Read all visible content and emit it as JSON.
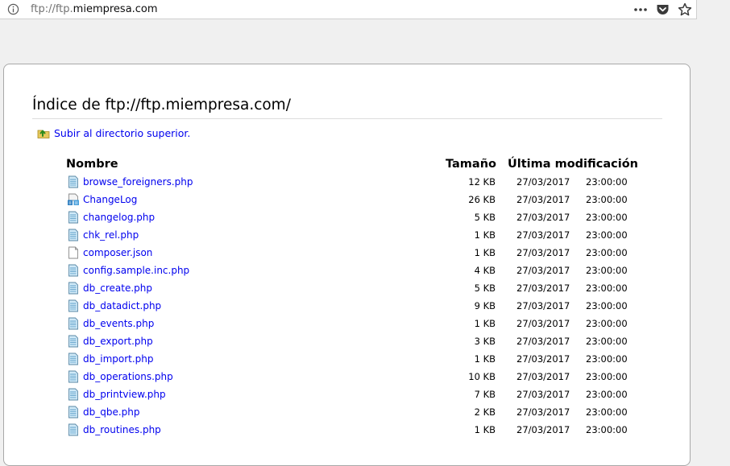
{
  "urlbar": {
    "url_prefix": "ftp://ftp.",
    "url_host": "miempresa.com"
  },
  "page": {
    "heading": "Índice de ftp://ftp.miempresa.com/",
    "up_link": "Subir al directorio superior."
  },
  "table": {
    "headers": {
      "name": "Nombre",
      "size": "Tamaño",
      "modified": "Última modificación"
    },
    "rows": [
      {
        "name": "browse_foreigners.php",
        "icon": "php-file-icon",
        "size": "12 KB",
        "date": "27/03/2017",
        "time": "23:00:00"
      },
      {
        "name": "ChangeLog",
        "icon": "changelog-file-icon",
        "size": "26 KB",
        "date": "27/03/2017",
        "time": "23:00:00"
      },
      {
        "name": "changelog.php",
        "icon": "php-file-icon",
        "size": "5 KB",
        "date": "27/03/2017",
        "time": "23:00:00"
      },
      {
        "name": "chk_rel.php",
        "icon": "php-file-icon",
        "size": "1 KB",
        "date": "27/03/2017",
        "time": "23:00:00"
      },
      {
        "name": "composer.json",
        "icon": "blank-file-icon",
        "size": "1 KB",
        "date": "27/03/2017",
        "time": "23:00:00"
      },
      {
        "name": "config.sample.inc.php",
        "icon": "php-file-icon",
        "size": "4 KB",
        "date": "27/03/2017",
        "time": "23:00:00"
      },
      {
        "name": "db_create.php",
        "icon": "php-file-icon",
        "size": "5 KB",
        "date": "27/03/2017",
        "time": "23:00:00"
      },
      {
        "name": "db_datadict.php",
        "icon": "php-file-icon",
        "size": "9 KB",
        "date": "27/03/2017",
        "time": "23:00:00"
      },
      {
        "name": "db_events.php",
        "icon": "php-file-icon",
        "size": "1 KB",
        "date": "27/03/2017",
        "time": "23:00:00"
      },
      {
        "name": "db_export.php",
        "icon": "php-file-icon",
        "size": "3 KB",
        "date": "27/03/2017",
        "time": "23:00:00"
      },
      {
        "name": "db_import.php",
        "icon": "php-file-icon",
        "size": "1 KB",
        "date": "27/03/2017",
        "time": "23:00:00"
      },
      {
        "name": "db_operations.php",
        "icon": "php-file-icon",
        "size": "10 KB",
        "date": "27/03/2017",
        "time": "23:00:00"
      },
      {
        "name": "db_printview.php",
        "icon": "php-file-icon",
        "size": "7 KB",
        "date": "27/03/2017",
        "time": "23:00:00"
      },
      {
        "name": "db_qbe.php",
        "icon": "php-file-icon",
        "size": "2 KB",
        "date": "27/03/2017",
        "time": "23:00:00"
      },
      {
        "name": "db_routines.php",
        "icon": "php-file-icon",
        "size": "1 KB",
        "date": "27/03/2017",
        "time": "23:00:00"
      }
    ]
  },
  "colors": {
    "link": "#0000ee",
    "card_border": "#a8a8a8",
    "background": "#f0f0f0"
  }
}
